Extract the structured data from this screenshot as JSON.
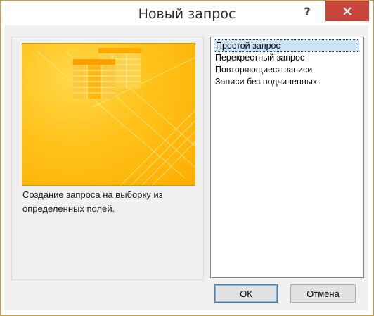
{
  "window": {
    "title": "Новый запрос"
  },
  "title_buttons": {
    "help": "?",
    "close_icon": "close-icon"
  },
  "preview": {
    "image": "query-wizard-illustration",
    "description": "Создание запроса на выборку из определенных полей."
  },
  "query_types": [
    {
      "label": "Простой запрос",
      "selected": true
    },
    {
      "label": "Перекрестный запрос",
      "selected": false
    },
    {
      "label": "Повторяющиеся записи",
      "selected": false
    },
    {
      "label": "Записи без подчиненных",
      "selected": false
    }
  ],
  "buttons": {
    "ok": "ОК",
    "cancel": "Отмена"
  },
  "colors": {
    "accent_yellow": "#ffc21a",
    "close_red": "#c7453a",
    "selection": "#cce4f7"
  }
}
